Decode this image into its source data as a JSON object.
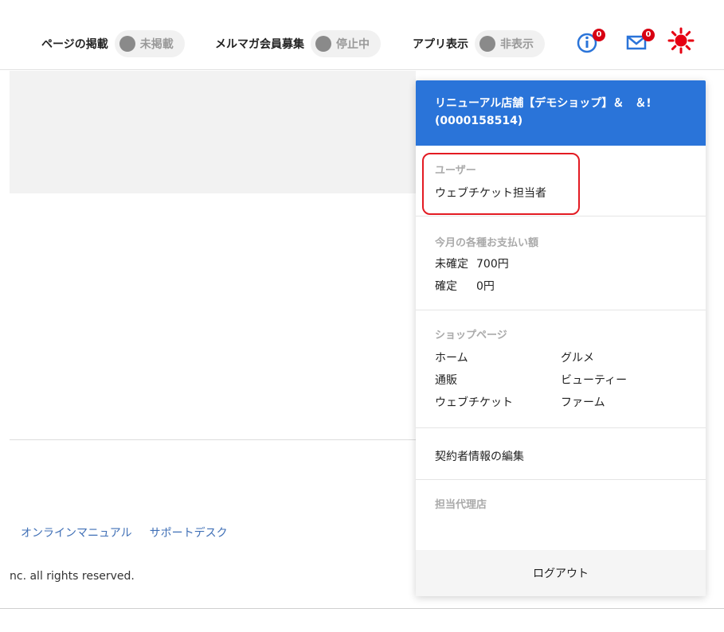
{
  "header": {
    "status": [
      {
        "label": "ページの掲載",
        "value": "未掲載"
      },
      {
        "label": "メルマガ会員募集",
        "value": "停止中"
      },
      {
        "label": "アプリ表示",
        "value": "非表示"
      }
    ],
    "info_badge": "0",
    "mail_badge": "0",
    "colors": {
      "status_dot": "#8a8a8a",
      "badge": "#d80012",
      "sun": "#e60012",
      "icon_blue": "#2a74d9"
    }
  },
  "footer": {
    "links": [
      "オンラインマニュアル",
      "サポートデスク"
    ],
    "copyright": "nc. all rights reserved."
  },
  "dropdown": {
    "shop_name": "リニューアル店舗【デモショップ】＆　＆!",
    "shop_id": "(0000158514)",
    "user_label": "ユーザー",
    "user_value": "ウェブチケット担当者",
    "pay_label": "今月の各種お支払い額",
    "pay_rows": [
      {
        "key": "未確定",
        "value": "700円"
      },
      {
        "key": "確定",
        "value": "0円"
      }
    ],
    "shop_label": "ショップページ",
    "shop_links": [
      "ホーム",
      "グルメ",
      "通販",
      "ビューティー",
      "ウェブチケット",
      "ファーム"
    ],
    "contract_edit": "契約者情報の編集",
    "agent_label": "担当代理店",
    "logout": "ログアウト",
    "colors": {
      "header_bg": "#2a74d9",
      "highlight": "#e31b23"
    }
  }
}
